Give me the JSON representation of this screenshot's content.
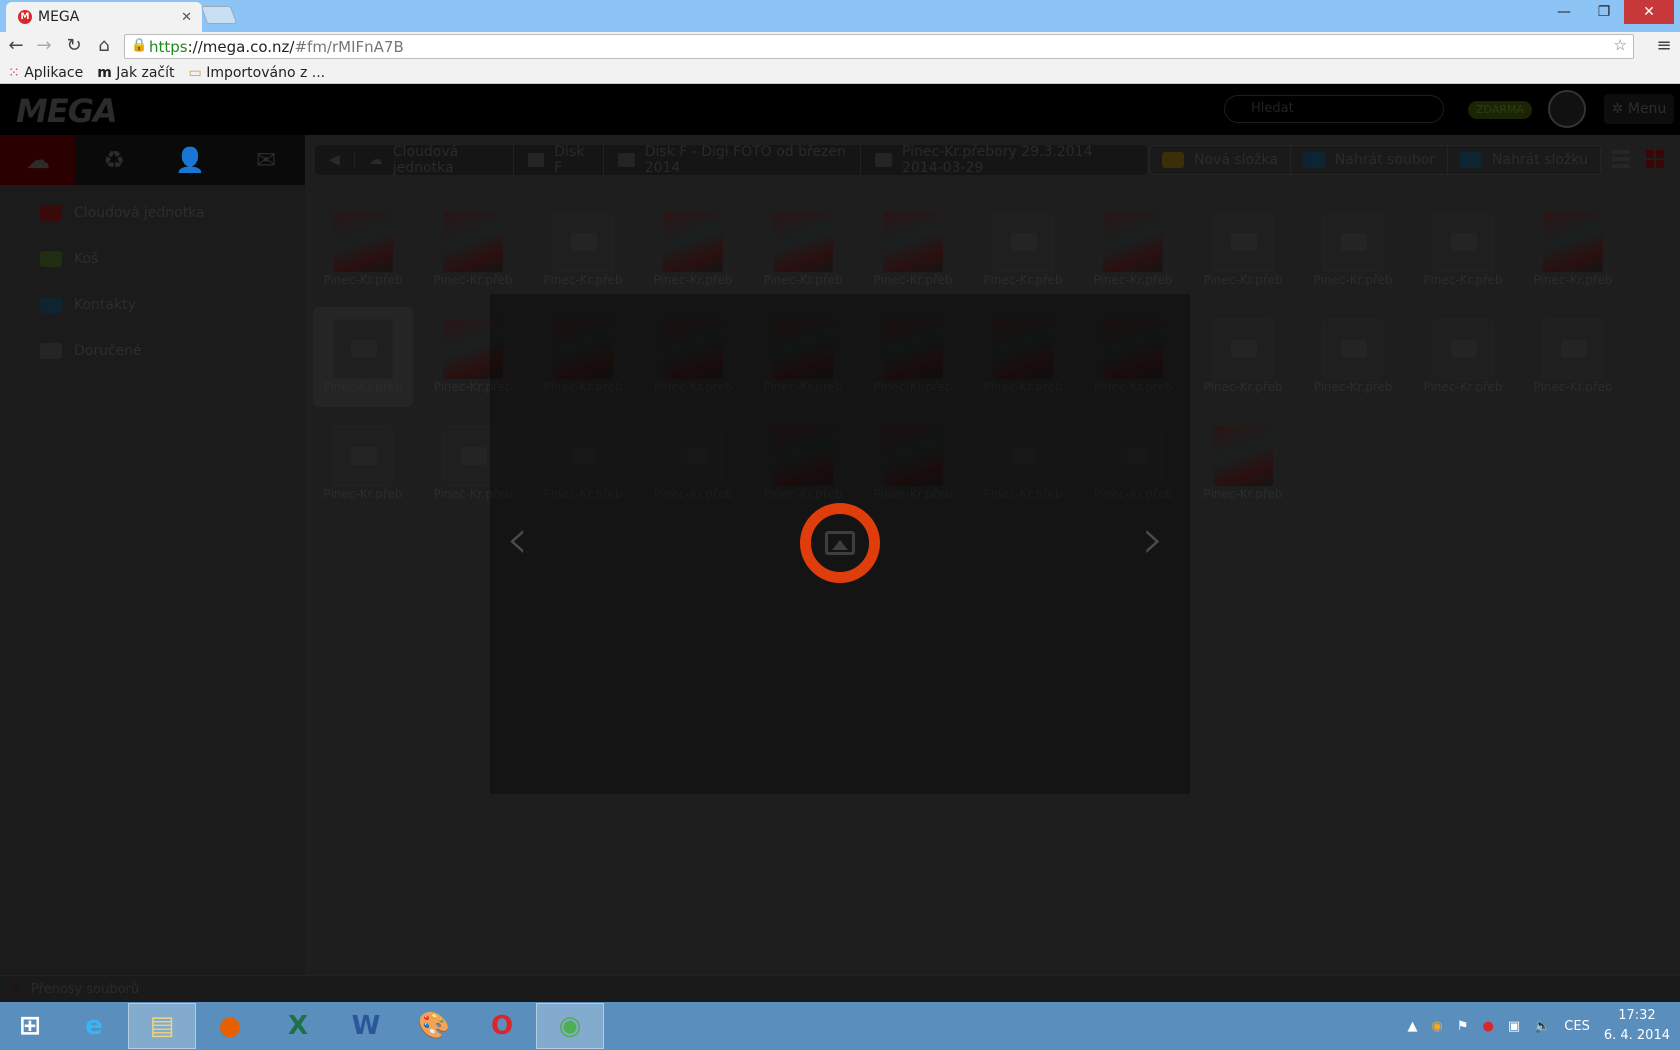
{
  "browser": {
    "tab_title": "MEGA",
    "url_scheme": "https",
    "url_host": "://mega.co.nz/",
    "url_path": "#fm/rMIFnA7B",
    "bookmarks": [
      "Aplikace",
      "Jak začít",
      "Importováno z ..."
    ]
  },
  "header": {
    "logo": "MEGA",
    "search_placeholder": "Hledat",
    "plan_badge": "ZDARMA",
    "menu_label": "Menu"
  },
  "sidebar": {
    "items": [
      {
        "label": "Cloudová jednotka",
        "color": "#3a0a0a"
      },
      {
        "label": "Koš",
        "color": "#1f2e12"
      },
      {
        "label": "Kontakty",
        "color": "#0f2433"
      },
      {
        "label": "Doručené",
        "color": "#252525"
      }
    ]
  },
  "breadcrumb": [
    "Cloudová jednotka",
    "Disk F",
    "Disk F - Digi FOTO od březen 2014",
    "Pinec-Kr.přebory 29.3.2014 2014-03-29"
  ],
  "actions": [
    {
      "label": "Nová složka",
      "color": "#3a2f08"
    },
    {
      "label": "Nahrát soubor",
      "color": "#0d2533"
    },
    {
      "label": "Nahrát složku",
      "color": "#0d2533"
    }
  ],
  "files": {
    "caption": "Pinec-Kr.přeb",
    "rows": [
      [
        "photo",
        "photo",
        "ph",
        "photo",
        "photo",
        "photo",
        "ph",
        "photo",
        "ph",
        "ph",
        "ph",
        "photo"
      ],
      [
        "ph",
        "photo",
        "photo",
        "photo",
        "photo",
        "photo",
        "photo",
        "photo",
        "ph",
        "ph",
        "ph",
        "ph"
      ],
      [
        "ph",
        "ph",
        "ph",
        "ph",
        "photo",
        "photo",
        "ph",
        "ph",
        "photo"
      ]
    ],
    "selected": [
      1,
      0
    ]
  },
  "viewer": {
    "prev": "‹",
    "next": "›",
    "accent": "#e03d0c"
  },
  "transfers": {
    "label": "Přenosy souborů"
  },
  "taskbar": {
    "apps": [
      "windows-start",
      "internet-explorer",
      "file-explorer",
      "firefox",
      "excel",
      "word",
      "paint",
      "opera",
      "chrome"
    ],
    "active": "chrome",
    "lang": "CES",
    "time": "17:32",
    "date": "6. 4. 2014"
  }
}
